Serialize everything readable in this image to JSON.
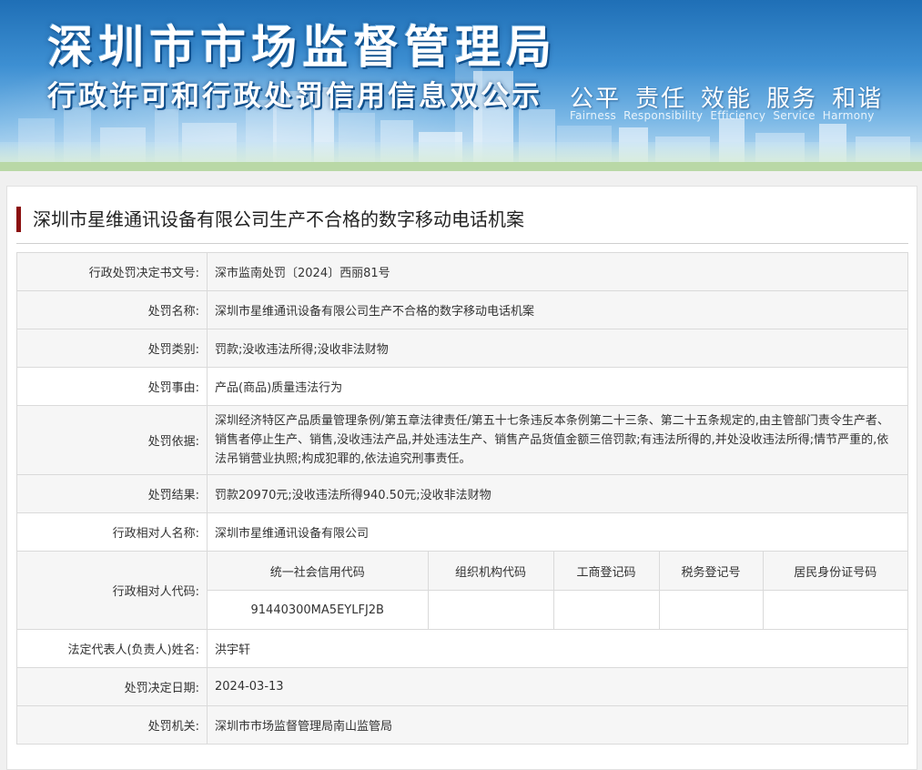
{
  "banner": {
    "title": "深圳市市场监督管理局",
    "subtitle": "行政许可和行政处罚信用信息双公示",
    "slogans": [
      "公平",
      "责任",
      "效能",
      "服务",
      "和谐"
    ],
    "slogans_en": [
      "Fairness",
      "Responsibility",
      "Efficiency",
      "Service",
      "Harmony"
    ]
  },
  "case": {
    "title": "深圳市星维通讯设备有限公司生产不合格的数字移动电话机案"
  },
  "rows": [
    {
      "label": "行政处罚决定书文号:",
      "value": "深市监南处罚〔2024〕西丽81号"
    },
    {
      "label": "处罚名称:",
      "value": "深圳市星维通讯设备有限公司生产不合格的数字移动电话机案"
    },
    {
      "label": "处罚类别:",
      "value": "罚款;没收违法所得;没收非法财物"
    },
    {
      "label": "处罚事由:",
      "value": "产品(商品)质量违法行为"
    },
    {
      "label": "处罚依据:",
      "value": "深圳经济特区产品质量管理条例/第五章法律责任/第五十七条违反本条例第二十三条、第二十五条规定的,由主管部门责令生产者、销售者停止生产、销售,没收违法产品,并处违法生产、销售产品货值金额三倍罚款;有违法所得的,并处没收违法所得;情节严重的,依法吊销营业执照;构成犯罪的,依法追究刑事责任。"
    },
    {
      "label": "处罚结果:",
      "value": "罚款20970元;没收违法所得940.50元;没收非法财物"
    },
    {
      "label": "行政相对人名称:",
      "value": "深圳市星维通讯设备有限公司"
    }
  ],
  "codes": {
    "label": "行政相对人代码:",
    "headers": [
      "统一社会信用代码",
      "组织机构代码",
      "工商登记码",
      "税务登记号",
      "居民身份证号码"
    ],
    "values": [
      "91440300MA5EYLFJ2B",
      "",
      "",
      "",
      ""
    ]
  },
  "rows_after": [
    {
      "label": "法定代表人(负责人)姓名:",
      "value": "洪宇轩"
    },
    {
      "label": "处罚决定日期:",
      "value": "2024-03-13"
    },
    {
      "label": "处罚机关:",
      "value": "深圳市市场监督管理局南山监管局"
    }
  ]
}
